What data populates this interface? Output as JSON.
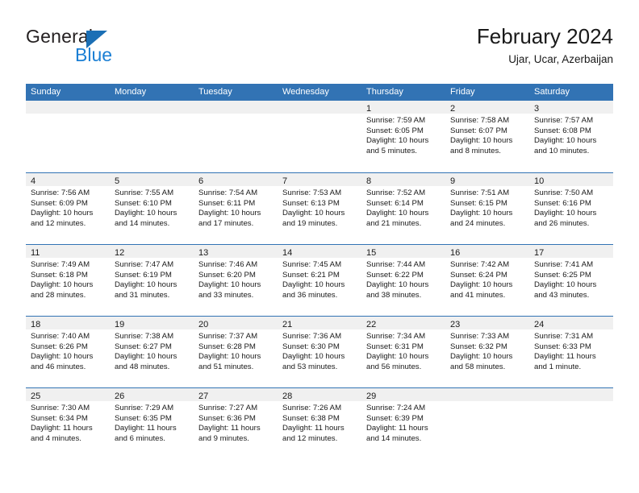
{
  "brand": {
    "name_top": "General",
    "name_bottom": "Blue",
    "triangle_color": "#1b6fb5",
    "blue_color": "#1b7fd4"
  },
  "header": {
    "title": "February 2024",
    "subtitle": "Ujar, Ucar, Azerbaijan"
  },
  "colors": {
    "header_band": "#3273b4",
    "daynum_band": "#f0f0f0",
    "row_divider": "#3273b4",
    "text": "#1a1a1a"
  },
  "weekday_headers": [
    "Sunday",
    "Monday",
    "Tuesday",
    "Wednesday",
    "Thursday",
    "Friday",
    "Saturday"
  ],
  "weeks": [
    [
      {
        "day": "",
        "sunrise": "",
        "sunset": "",
        "daylight": ""
      },
      {
        "day": "",
        "sunrise": "",
        "sunset": "",
        "daylight": ""
      },
      {
        "day": "",
        "sunrise": "",
        "sunset": "",
        "daylight": ""
      },
      {
        "day": "",
        "sunrise": "",
        "sunset": "",
        "daylight": ""
      },
      {
        "day": "1",
        "sunrise": "Sunrise: 7:59 AM",
        "sunset": "Sunset: 6:05 PM",
        "daylight": "Daylight: 10 hours and 5 minutes."
      },
      {
        "day": "2",
        "sunrise": "Sunrise: 7:58 AM",
        "sunset": "Sunset: 6:07 PM",
        "daylight": "Daylight: 10 hours and 8 minutes."
      },
      {
        "day": "3",
        "sunrise": "Sunrise: 7:57 AM",
        "sunset": "Sunset: 6:08 PM",
        "daylight": "Daylight: 10 hours and 10 minutes."
      }
    ],
    [
      {
        "day": "4",
        "sunrise": "Sunrise: 7:56 AM",
        "sunset": "Sunset: 6:09 PM",
        "daylight": "Daylight: 10 hours and 12 minutes."
      },
      {
        "day": "5",
        "sunrise": "Sunrise: 7:55 AM",
        "sunset": "Sunset: 6:10 PM",
        "daylight": "Daylight: 10 hours and 14 minutes."
      },
      {
        "day": "6",
        "sunrise": "Sunrise: 7:54 AM",
        "sunset": "Sunset: 6:11 PM",
        "daylight": "Daylight: 10 hours and 17 minutes."
      },
      {
        "day": "7",
        "sunrise": "Sunrise: 7:53 AM",
        "sunset": "Sunset: 6:13 PM",
        "daylight": "Daylight: 10 hours and 19 minutes."
      },
      {
        "day": "8",
        "sunrise": "Sunrise: 7:52 AM",
        "sunset": "Sunset: 6:14 PM",
        "daylight": "Daylight: 10 hours and 21 minutes."
      },
      {
        "day": "9",
        "sunrise": "Sunrise: 7:51 AM",
        "sunset": "Sunset: 6:15 PM",
        "daylight": "Daylight: 10 hours and 24 minutes."
      },
      {
        "day": "10",
        "sunrise": "Sunrise: 7:50 AM",
        "sunset": "Sunset: 6:16 PM",
        "daylight": "Daylight: 10 hours and 26 minutes."
      }
    ],
    [
      {
        "day": "11",
        "sunrise": "Sunrise: 7:49 AM",
        "sunset": "Sunset: 6:18 PM",
        "daylight": "Daylight: 10 hours and 28 minutes."
      },
      {
        "day": "12",
        "sunrise": "Sunrise: 7:47 AM",
        "sunset": "Sunset: 6:19 PM",
        "daylight": "Daylight: 10 hours and 31 minutes."
      },
      {
        "day": "13",
        "sunrise": "Sunrise: 7:46 AM",
        "sunset": "Sunset: 6:20 PM",
        "daylight": "Daylight: 10 hours and 33 minutes."
      },
      {
        "day": "14",
        "sunrise": "Sunrise: 7:45 AM",
        "sunset": "Sunset: 6:21 PM",
        "daylight": "Daylight: 10 hours and 36 minutes."
      },
      {
        "day": "15",
        "sunrise": "Sunrise: 7:44 AM",
        "sunset": "Sunset: 6:22 PM",
        "daylight": "Daylight: 10 hours and 38 minutes."
      },
      {
        "day": "16",
        "sunrise": "Sunrise: 7:42 AM",
        "sunset": "Sunset: 6:24 PM",
        "daylight": "Daylight: 10 hours and 41 minutes."
      },
      {
        "day": "17",
        "sunrise": "Sunrise: 7:41 AM",
        "sunset": "Sunset: 6:25 PM",
        "daylight": "Daylight: 10 hours and 43 minutes."
      }
    ],
    [
      {
        "day": "18",
        "sunrise": "Sunrise: 7:40 AM",
        "sunset": "Sunset: 6:26 PM",
        "daylight": "Daylight: 10 hours and 46 minutes."
      },
      {
        "day": "19",
        "sunrise": "Sunrise: 7:38 AM",
        "sunset": "Sunset: 6:27 PM",
        "daylight": "Daylight: 10 hours and 48 minutes."
      },
      {
        "day": "20",
        "sunrise": "Sunrise: 7:37 AM",
        "sunset": "Sunset: 6:28 PM",
        "daylight": "Daylight: 10 hours and 51 minutes."
      },
      {
        "day": "21",
        "sunrise": "Sunrise: 7:36 AM",
        "sunset": "Sunset: 6:30 PM",
        "daylight": "Daylight: 10 hours and 53 minutes."
      },
      {
        "day": "22",
        "sunrise": "Sunrise: 7:34 AM",
        "sunset": "Sunset: 6:31 PM",
        "daylight": "Daylight: 10 hours and 56 minutes."
      },
      {
        "day": "23",
        "sunrise": "Sunrise: 7:33 AM",
        "sunset": "Sunset: 6:32 PM",
        "daylight": "Daylight: 10 hours and 58 minutes."
      },
      {
        "day": "24",
        "sunrise": "Sunrise: 7:31 AM",
        "sunset": "Sunset: 6:33 PM",
        "daylight": "Daylight: 11 hours and 1 minute."
      }
    ],
    [
      {
        "day": "25",
        "sunrise": "Sunrise: 7:30 AM",
        "sunset": "Sunset: 6:34 PM",
        "daylight": "Daylight: 11 hours and 4 minutes."
      },
      {
        "day": "26",
        "sunrise": "Sunrise: 7:29 AM",
        "sunset": "Sunset: 6:35 PM",
        "daylight": "Daylight: 11 hours and 6 minutes."
      },
      {
        "day": "27",
        "sunrise": "Sunrise: 7:27 AM",
        "sunset": "Sunset: 6:36 PM",
        "daylight": "Daylight: 11 hours and 9 minutes."
      },
      {
        "day": "28",
        "sunrise": "Sunrise: 7:26 AM",
        "sunset": "Sunset: 6:38 PM",
        "daylight": "Daylight: 11 hours and 12 minutes."
      },
      {
        "day": "29",
        "sunrise": "Sunrise: 7:24 AM",
        "sunset": "Sunset: 6:39 PM",
        "daylight": "Daylight: 11 hours and 14 minutes."
      },
      {
        "day": "",
        "sunrise": "",
        "sunset": "",
        "daylight": ""
      },
      {
        "day": "",
        "sunrise": "",
        "sunset": "",
        "daylight": ""
      }
    ]
  ]
}
